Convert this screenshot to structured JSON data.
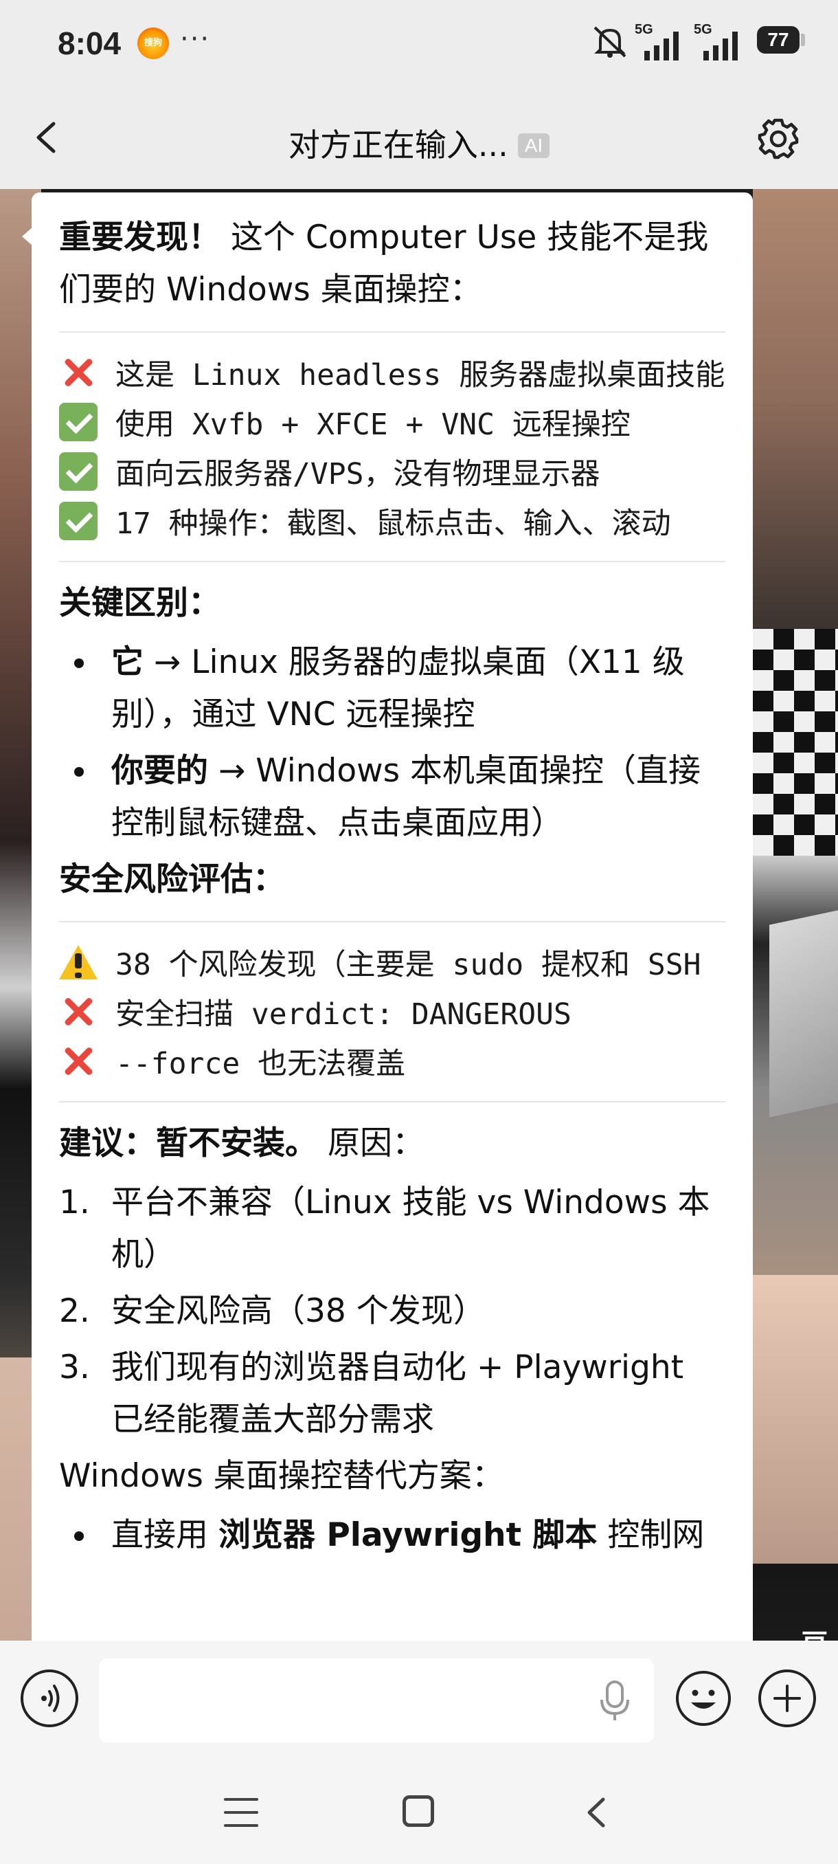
{
  "status_bar": {
    "time": "8:04",
    "app_icon_label": "搜狗",
    "more": "···",
    "network1": "5G",
    "network2": "5G",
    "battery": "77",
    "icons": [
      "mute-bell-icon",
      "signal-icon",
      "battery-icon"
    ]
  },
  "header": {
    "title": "对方正在输入...",
    "badge": "AI",
    "icons": [
      "back-arrow-icon",
      "settings-gear-icon"
    ]
  },
  "message": {
    "intro_bold": "重要发现！",
    "intro_rest": " 这个 Computer Use 技能不是我们要的 Windows 桌面操控：",
    "block1": [
      {
        "icon": "cross",
        "text": "这是 Linux headless 服务器虚拟桌面技能"
      },
      {
        "icon": "check",
        "text": "使用 Xvfb + XFCE + VNC 远程操控"
      },
      {
        "icon": "check",
        "text": "面向云服务器/VPS，没有物理显示器"
      },
      {
        "icon": "check",
        "text": "17 种操作：截图、鼠标点击、输入、滚动"
      }
    ],
    "section_key": "关键区别：",
    "diff_items": [
      {
        "bold": "它",
        "rest": " → Linux 服务器的虚拟桌面（X11 级别），通过 VNC 远程操控"
      },
      {
        "bold": "你要的",
        "rest": " → Windows 本机桌面操控（直接控制鼠标键盘、点击桌面应用）"
      }
    ],
    "section_security": "安全风险评估：",
    "block2": [
      {
        "icon": "warning",
        "text": "38 个风险发现（主要是 sudo 提权和 SSH"
      },
      {
        "icon": "cross",
        "text": "安全扫描 verdict: DANGEROUS"
      },
      {
        "icon": "cross",
        "text": "--force 也无法覆盖"
      }
    ],
    "recommend_bold": "建议：暂不安装。",
    "recommend_rest": " 原因：",
    "reasons": [
      {
        "num": "1.",
        "text": "平台不兼容（Linux 技能 vs Windows 本机）"
      },
      {
        "num": "2.",
        "text": "安全风险高（38 个发现）"
      },
      {
        "num": "3.",
        "text": "我们现有的浏览器自动化 + Playwright 已经能覆盖大部分需求"
      }
    ],
    "section_alt": "Windows 桌面操控替代方案：",
    "alt_items": [
      {
        "prefix": "直接用 ",
        "bold": "浏览器 Playwright 脚本",
        "rest": " 控制网"
      }
    ]
  },
  "background": {
    "watermark": "豆"
  },
  "input_bar": {
    "placeholder": "",
    "icons": [
      "voice-icon",
      "microphone-icon",
      "emoji-icon",
      "plus-icon"
    ]
  },
  "nav_bar": {
    "icons": [
      "menu-icon",
      "home-icon",
      "back-icon"
    ]
  }
}
